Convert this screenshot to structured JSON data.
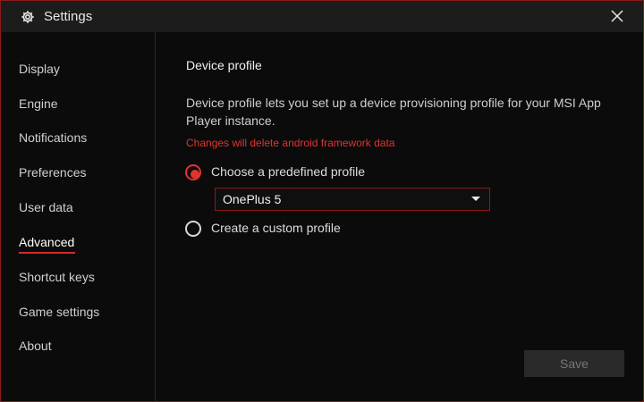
{
  "window": {
    "title": "Settings",
    "icon": "gear-icon",
    "close_icon": "close-icon"
  },
  "sidebar": {
    "items": [
      {
        "label": "Display"
      },
      {
        "label": "Engine"
      },
      {
        "label": "Notifications"
      },
      {
        "label": "Preferences"
      },
      {
        "label": "User data"
      },
      {
        "label": "Advanced",
        "active": true
      },
      {
        "label": "Shortcut keys"
      },
      {
        "label": "Game settings"
      },
      {
        "label": "About"
      }
    ]
  },
  "main": {
    "section_title": "Device profile",
    "description": "Device profile lets you set up a device provisioning profile for your MSI App Player instance.",
    "warning": "Changes will delete android framework data",
    "options": {
      "predefined": {
        "label": "Choose a predefined profile",
        "selected": true
      },
      "custom": {
        "label": "Create a custom profile",
        "selected": false
      }
    },
    "profile_select": {
      "value": "OnePlus 5"
    },
    "save_label": "Save"
  },
  "colors": {
    "accent": "#e0342f",
    "border": "#8a1a1a",
    "background": "#0b0b0b",
    "titlebar": "#1c1c1c"
  }
}
